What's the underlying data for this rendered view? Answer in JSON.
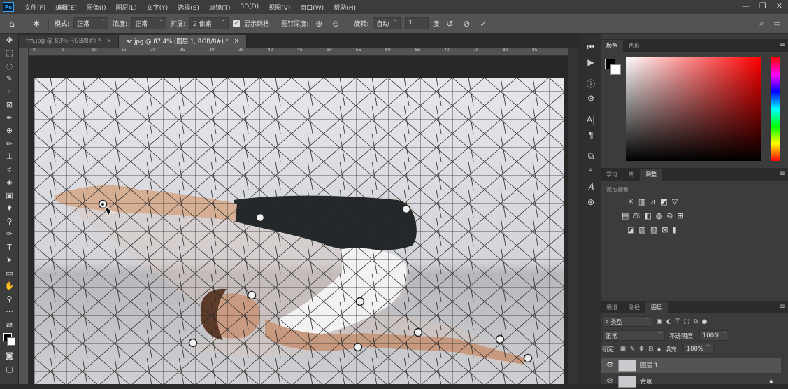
{
  "app": {
    "logo": "Ps"
  },
  "menu": [
    "文件(F)",
    "编辑(E)",
    "图像(I)",
    "图层(L)",
    "文字(Y)",
    "选择(S)",
    "滤镜(T)",
    "3D(D)",
    "视图(V)",
    "窗口(W)",
    "帮助(H)"
  ],
  "options": {
    "mode_label": "模式:",
    "mode_value": "正常",
    "density_label": "浓度:",
    "density_value": "正常",
    "expand_label": "扩展:",
    "expand_value": "2 像素",
    "show_mesh_label": "显示网格",
    "show_mesh_checked": true,
    "pin_depth_label": "图钉深度:",
    "rotate_label": "旋转:",
    "rotate_value": "自动",
    "angle_value": "1",
    "degree_label": "度"
  },
  "tabs": [
    {
      "label": "fm.jpg @ 89%(RGB/8#) *",
      "active": false
    },
    {
      "label": "sc.jpg @ 87.4% (图层 1, RGB/8#) *",
      "active": true
    }
  ],
  "ruler": [
    "0",
    "5",
    "10",
    "15",
    "20",
    "25",
    "30",
    "35",
    "40",
    "45",
    "50",
    "55",
    "60",
    "65",
    "70",
    "75",
    "80",
    "85"
  ],
  "color_panel": {
    "tabs": [
      "颜色",
      "色板"
    ],
    "hue_color": "#ff0000"
  },
  "adjust_panel": {
    "tabs": [
      "学习",
      "库",
      "调整"
    ],
    "title": "添加调整"
  },
  "layers_panel": {
    "tabs": [
      "通道",
      "路径",
      "图层"
    ],
    "search_placeholder": "类型",
    "blend_mode": "正常",
    "opacity_label": "不透明度:",
    "opacity_value": "100%",
    "lock_label": "锁定:",
    "fill_label": "填充:",
    "fill_value": "100%",
    "layers": [
      {
        "name": "图层 1",
        "selected": true
      },
      {
        "name": "背景",
        "selected": false
      }
    ]
  }
}
